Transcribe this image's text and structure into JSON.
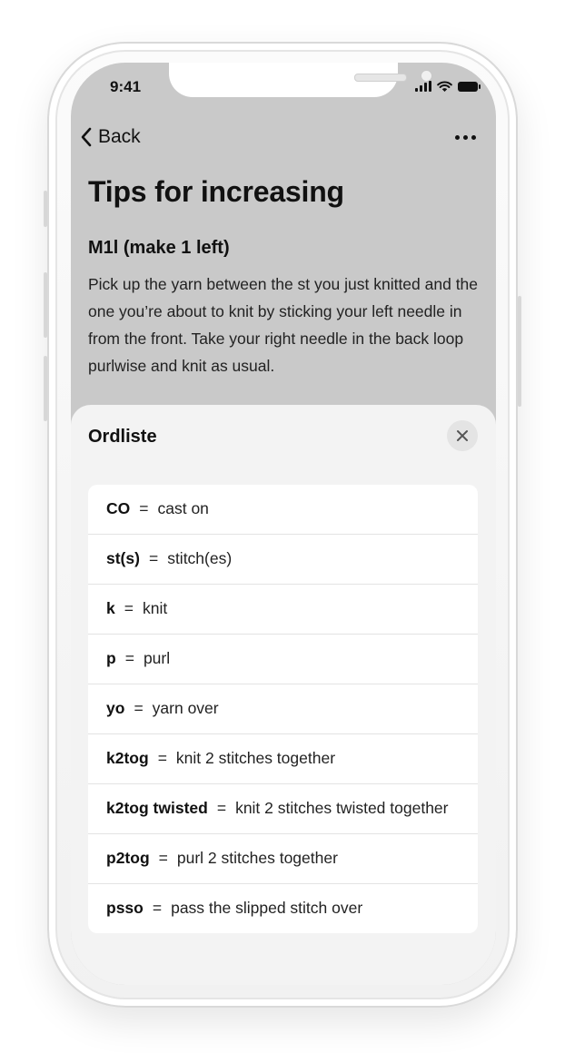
{
  "status_bar": {
    "time": "9:41"
  },
  "nav": {
    "back_label": "Back",
    "more_icon": "more-horizontal-icon"
  },
  "page": {
    "title": "Tips for increasing",
    "section_heading": "M1l (make 1 left)",
    "section_body": "Pick up the yarn between the st you just knitted and the one you’re about to knit by sticking your left needle in from the front. Take your right needle in the back loop purlwise and knit as usual."
  },
  "sheet": {
    "title": "Ordliste",
    "close_icon": "close-icon",
    "items": [
      {
        "term": "CO",
        "equals": "=",
        "definition": "cast on"
      },
      {
        "term": "st(s)",
        "equals": "=",
        "definition": "stitch(es)"
      },
      {
        "term": "k",
        "equals": "=",
        "definition": "knit"
      },
      {
        "term": "p",
        "equals": "=",
        "definition": "purl"
      },
      {
        "term": "yo",
        "equals": "=",
        "definition": "yarn over"
      },
      {
        "term": "k2tog",
        "equals": "=",
        "definition": "knit 2 stitches together"
      },
      {
        "term": "k2tog twisted",
        "equals": "=",
        "definition": "knit 2 stitches twisted together"
      },
      {
        "term": "p2tog",
        "equals": "=",
        "definition": "purl 2 stitches together"
      },
      {
        "term": "psso",
        "equals": "=",
        "definition": "pass the slipped stitch over"
      }
    ]
  },
  "colors": {
    "dimmed_background": "#c9c9c9",
    "sheet_background": "#f3f3f3",
    "list_background": "#ffffff",
    "text": "#111111"
  }
}
